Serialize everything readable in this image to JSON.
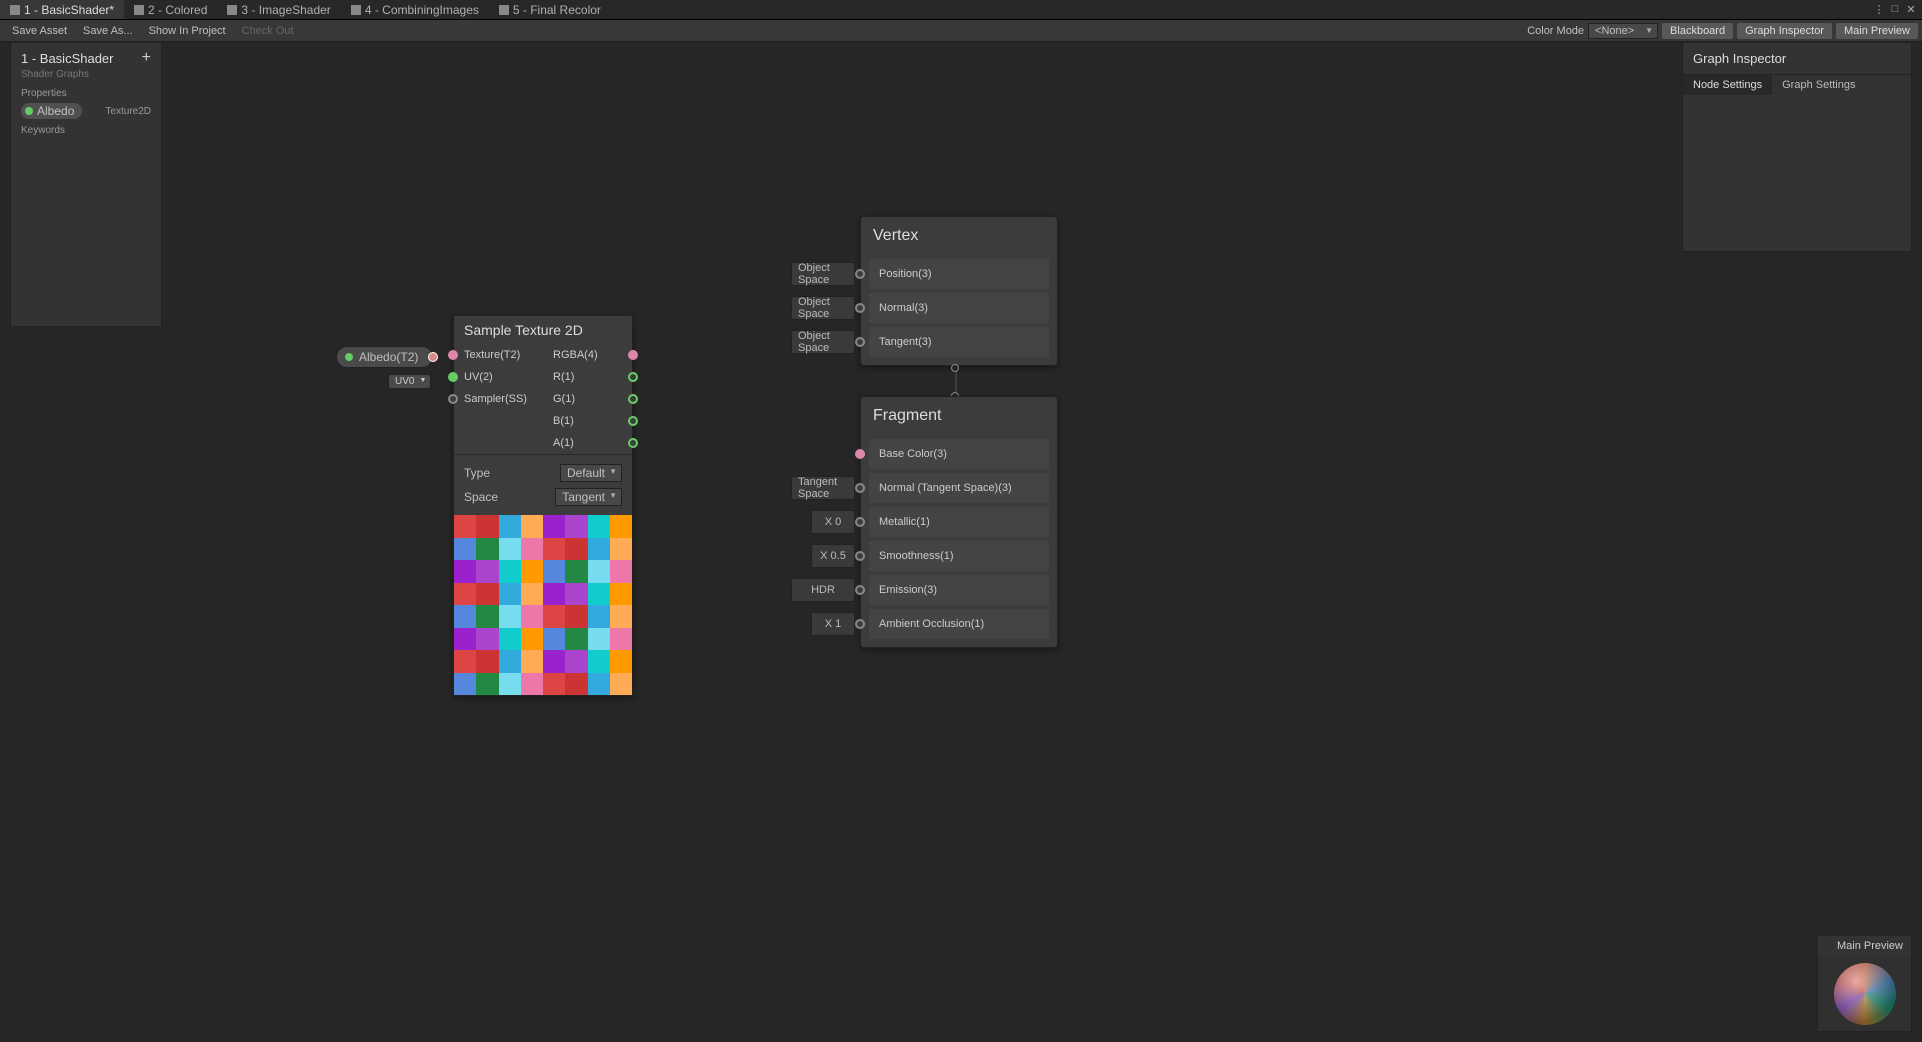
{
  "tabs": [
    {
      "label": "1 - BasicShader*",
      "active": true
    },
    {
      "label": "2 - Colored"
    },
    {
      "label": "3 - ImageShader"
    },
    {
      "label": "4 - CombiningImages"
    },
    {
      "label": "5 - Final Recolor"
    }
  ],
  "toolbar": {
    "save_asset": "Save Asset",
    "save_as": "Save As...",
    "show_in_project": "Show In Project",
    "check_out": "Check Out",
    "color_mode_label": "Color Mode",
    "color_mode_value": "<None>",
    "blackboard": "Blackboard",
    "graph_inspector": "Graph Inspector",
    "main_preview": "Main Preview"
  },
  "blackboard": {
    "title": "1 - BasicShader",
    "subtitle": "Shader Graphs",
    "section_properties": "Properties",
    "prop_name": "Albedo",
    "prop_type": "Texture2D",
    "section_keywords": "Keywords"
  },
  "inspector": {
    "title": "Graph Inspector",
    "tab_node": "Node Settings",
    "tab_graph": "Graph Settings"
  },
  "main_preview": {
    "title": "Main Preview"
  },
  "prop_node": {
    "label": "Albedo(T2)"
  },
  "uv_pill": {
    "label": "UV0"
  },
  "sample_tex": {
    "title": "Sample Texture 2D",
    "in_texture": "Texture(T2)",
    "in_uv": "UV(2)",
    "in_sampler": "Sampler(SS)",
    "out_rgba": "RGBA(4)",
    "out_r": "R(1)",
    "out_g": "G(1)",
    "out_b": "B(1)",
    "out_a": "A(1)",
    "type_label": "Type",
    "type_value": "Default",
    "space_label": "Space",
    "space_value": "Tangent"
  },
  "vertex": {
    "title": "Vertex",
    "rows": [
      {
        "pre": "Object Space",
        "label": "Position(3)"
      },
      {
        "pre": "Object Space",
        "label": "Normal(3)"
      },
      {
        "pre": "Object Space",
        "label": "Tangent(3)"
      }
    ]
  },
  "fragment": {
    "title": "Fragment",
    "rows": [
      {
        "pre": "",
        "label": "Base Color(3)",
        "dot": "pinkf"
      },
      {
        "pre": "Tangent Space",
        "label": "Normal (Tangent Space)(3)"
      },
      {
        "pre": "X 0",
        "label": "Metallic(1)",
        "x": true
      },
      {
        "pre": "X 0.5",
        "label": "Smoothness(1)",
        "x": true
      },
      {
        "pre": "HDR",
        "label": "Emission(3)"
      },
      {
        "pre": "X 1",
        "label": "Ambient Occlusion(1)",
        "x": true
      }
    ]
  }
}
